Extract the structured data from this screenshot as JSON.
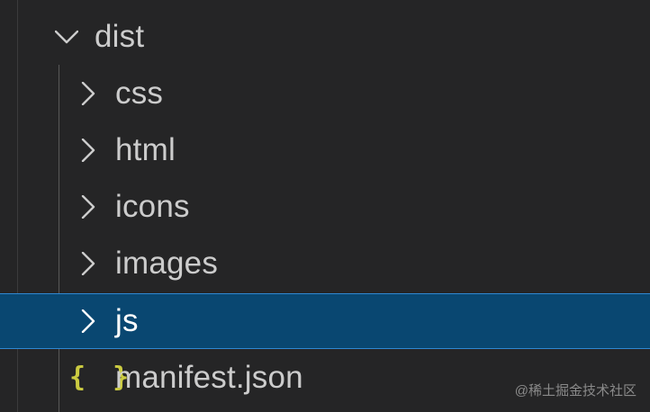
{
  "explorer": {
    "root": {
      "label": "dist",
      "expanded": true,
      "icon": "chevron-down-icon"
    },
    "children": [
      {
        "label": "css",
        "type": "folder",
        "icon": "chevron-right-icon"
      },
      {
        "label": "html",
        "type": "folder",
        "icon": "chevron-right-icon"
      },
      {
        "label": "icons",
        "type": "folder",
        "icon": "chevron-right-icon"
      },
      {
        "label": "images",
        "type": "folder",
        "icon": "chevron-right-icon"
      },
      {
        "label": "js",
        "type": "folder",
        "icon": "chevron-right-icon",
        "selected": true
      },
      {
        "label": "manifest.json",
        "type": "file",
        "icon": "json-file-icon",
        "icon_glyph": "{ }"
      }
    ]
  },
  "watermark": "@稀土掘金技术社区",
  "colors": {
    "background": "#252526",
    "text": "#cccccc",
    "selection_bg": "#094771",
    "selection_border": "#2f88d2",
    "json_icon": "#cbcb41"
  }
}
